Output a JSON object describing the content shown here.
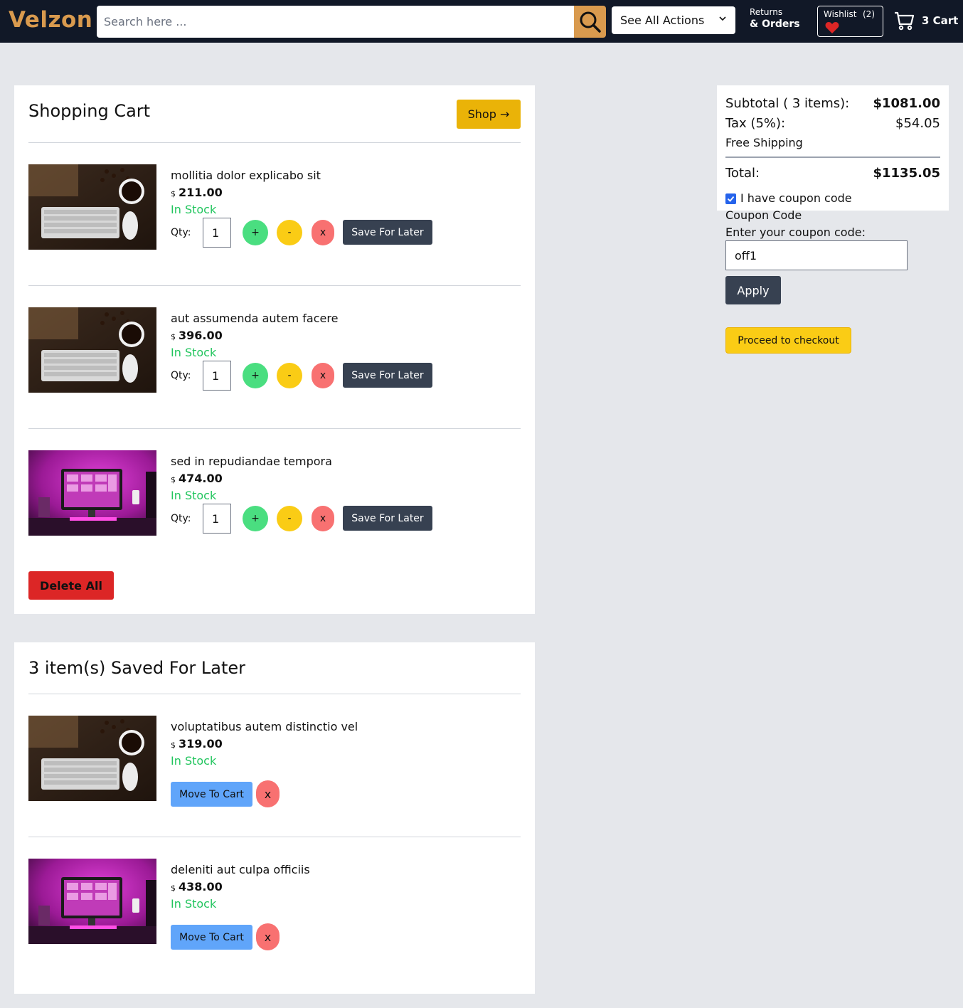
{
  "header": {
    "logo": "Velzon",
    "search_placeholder": "Search here ...",
    "actions_label": "See All Actions",
    "returns_line1": "Returns",
    "returns_line2": "& Orders",
    "wishlist_label": "Wishlist",
    "wishlist_count": "(2)",
    "cart_label": "3 Cart"
  },
  "cart": {
    "title": "Shopping Cart",
    "shop_button": "Shop →",
    "qty_label": "Qty:",
    "plus_label": "+",
    "minus_label": "-",
    "remove_label": "x",
    "save_for_later_label": "Save For Later",
    "delete_all_label": "Delete All",
    "currency": "$",
    "items": [
      {
        "name": "mollitia dolor explicabo sit",
        "price": "211.00",
        "stock": "In Stock",
        "qty": "1",
        "image": "keyboard-coffee"
      },
      {
        "name": "aut assumenda autem facere",
        "price": "396.00",
        "stock": "In Stock",
        "qty": "1",
        "image": "keyboard-coffee"
      },
      {
        "name": "sed in repudiandae tempora",
        "price": "474.00",
        "stock": "In Stock",
        "qty": "1",
        "image": "pink-desk"
      }
    ]
  },
  "saved": {
    "title": "3 item(s) Saved For Later",
    "move_label": "Move To Cart",
    "remove_label": "x",
    "items": [
      {
        "name": "voluptatibus autem distinctio vel",
        "price": "319.00",
        "stock": "In Stock",
        "image": "keyboard-coffee"
      },
      {
        "name": "deleniti aut culpa officiis",
        "price": "438.00",
        "stock": "In Stock",
        "image": "pink-desk"
      }
    ]
  },
  "summary": {
    "subtotal_label": "Subtotal ( 3 items):",
    "subtotal_value": "$1081.00",
    "tax_label": "Tax (5%):",
    "tax_value": "$54.05",
    "shipping": "Free Shipping",
    "total_label": "Total:",
    "total_value": "$1135.05",
    "coupon_checkbox_label": "I have coupon code",
    "coupon_checked": true,
    "coupon_title": "Coupon Code",
    "coupon_prompt": "Enter your coupon code:",
    "coupon_value": "off1",
    "apply_label": "Apply",
    "checkout_label": "Proceed to checkout"
  },
  "colors": {
    "header_bg": "#111827",
    "brand": "#d99a4e",
    "in_stock": "#22c55e",
    "delete_all": "#dc2626",
    "checkout": "#facc15"
  }
}
